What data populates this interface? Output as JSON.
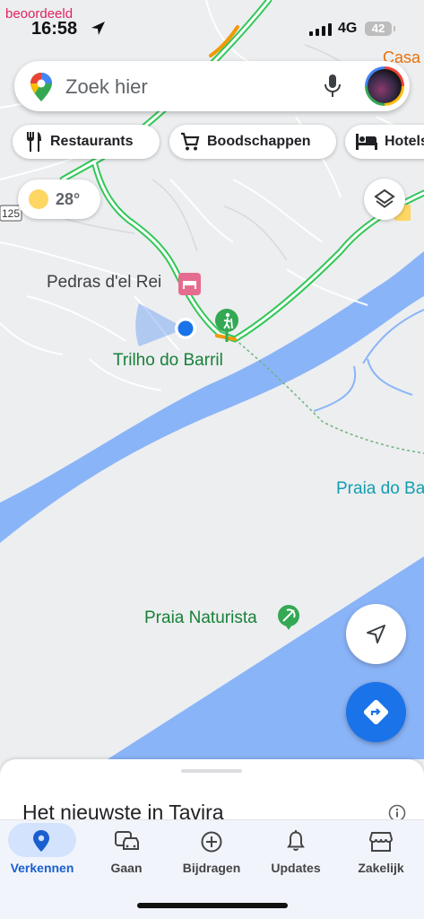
{
  "status_bar": {
    "overlay_tag": "beoordeeld",
    "time": "16:58",
    "network": "4G",
    "battery": "42"
  },
  "search": {
    "placeholder": "Zoek hier"
  },
  "chips": [
    {
      "label": "Restaurants",
      "icon": "fork-knife-icon"
    },
    {
      "label": "Boodschappen",
      "icon": "cart-icon"
    },
    {
      "label": "Hotels",
      "icon": "bed-icon"
    }
  ],
  "weather": {
    "temperature": "28°",
    "icon": "sun-icon"
  },
  "map": {
    "places": {
      "pedras": "Pedras d'el Rei",
      "trilho": "Trilho do Barril",
      "praia_barril": "Praia do Barril",
      "praia_naturista": "Praia Naturista",
      "casa": "Casa",
      "road_number": "125"
    },
    "colors": {
      "water": "#8ab4f8",
      "land": "#eceef0",
      "traffic_green": "#34c759",
      "park_label": "#188038",
      "beach_label": "#129eaf",
      "hotel_pin": "#e66c8f",
      "location_dot": "#1a73e8"
    }
  },
  "sheet": {
    "title": "Het nieuwste in Tavira"
  },
  "bottom_nav": [
    {
      "label": "Verkennen",
      "icon": "location-pin-icon",
      "active": true
    },
    {
      "label": "Gaan",
      "icon": "commute-icon",
      "active": false
    },
    {
      "label": "Bijdragen",
      "icon": "add-circle-icon",
      "active": false
    },
    {
      "label": "Updates",
      "icon": "bell-icon",
      "active": false
    },
    {
      "label": "Zakelijk",
      "icon": "store-icon",
      "active": false
    }
  ]
}
